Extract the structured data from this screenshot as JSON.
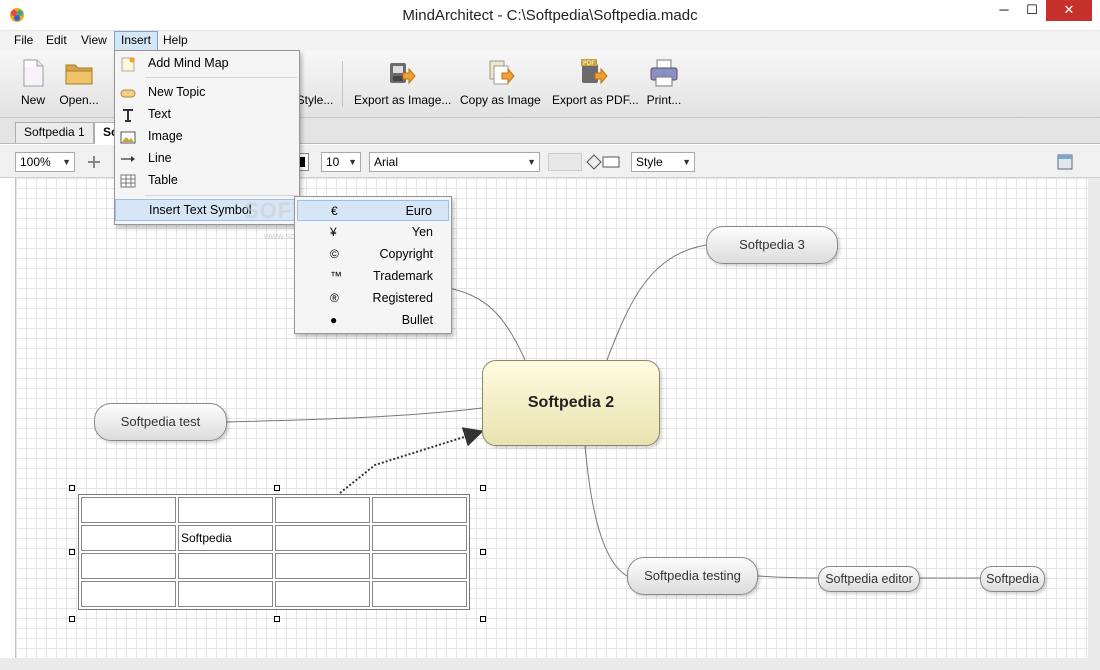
{
  "window": {
    "title": "MindArchitect - C:\\Softpedia\\Softpedia.madc",
    "min_glyph": "─",
    "max_glyph": "☐",
    "close_glyph": "✕"
  },
  "menubar": {
    "items": [
      "File",
      "Edit",
      "View",
      "Insert",
      "Help"
    ]
  },
  "toolbar": {
    "new_label": "New",
    "open_label": "Open...",
    "style_label": "Style...",
    "export_image_label": "Export as Image...",
    "copy_image_label": "Copy as Image",
    "export_pdf_label": "Export as PDF...",
    "print_label": "Print..."
  },
  "tabs": {
    "items": [
      "Softpedia 1",
      "So"
    ]
  },
  "formatbar": {
    "zoom": "100%",
    "font_size": "10",
    "font_family": "Arial",
    "style": "Style"
  },
  "insert_menu": {
    "items": [
      "Add Mind Map",
      "New Topic",
      "Text",
      "Image",
      "Line",
      "Table",
      "Insert Text Symbol"
    ],
    "highlighted": "Insert Text Symbol"
  },
  "symbol_submenu": {
    "items": [
      {
        "symbol": "€",
        "name": "Euro"
      },
      {
        "symbol": "¥",
        "name": "Yen"
      },
      {
        "symbol": "©",
        "name": "Copyright"
      },
      {
        "symbol": "™",
        "name": "Trademark"
      },
      {
        "symbol": "®",
        "name": "Registered"
      },
      {
        "symbol": "●",
        "name": "Bullet"
      }
    ],
    "highlighted": "Euro"
  },
  "mindmap": {
    "central": "Softpedia 2",
    "topics": [
      "Softpedia 3",
      "Softpedia test",
      "Softpedia testing",
      "Softpedia editor",
      "Softpedia"
    ],
    "table_cell_text": "Softpedia"
  },
  "watermark": {
    "text": "SOFTPEDIA",
    "url": "www.softpedia.com"
  },
  "colors": {
    "central_fill": "#f3eec7",
    "menu_highlight": "#d7e6f6",
    "close_button": "#c7312b"
  }
}
